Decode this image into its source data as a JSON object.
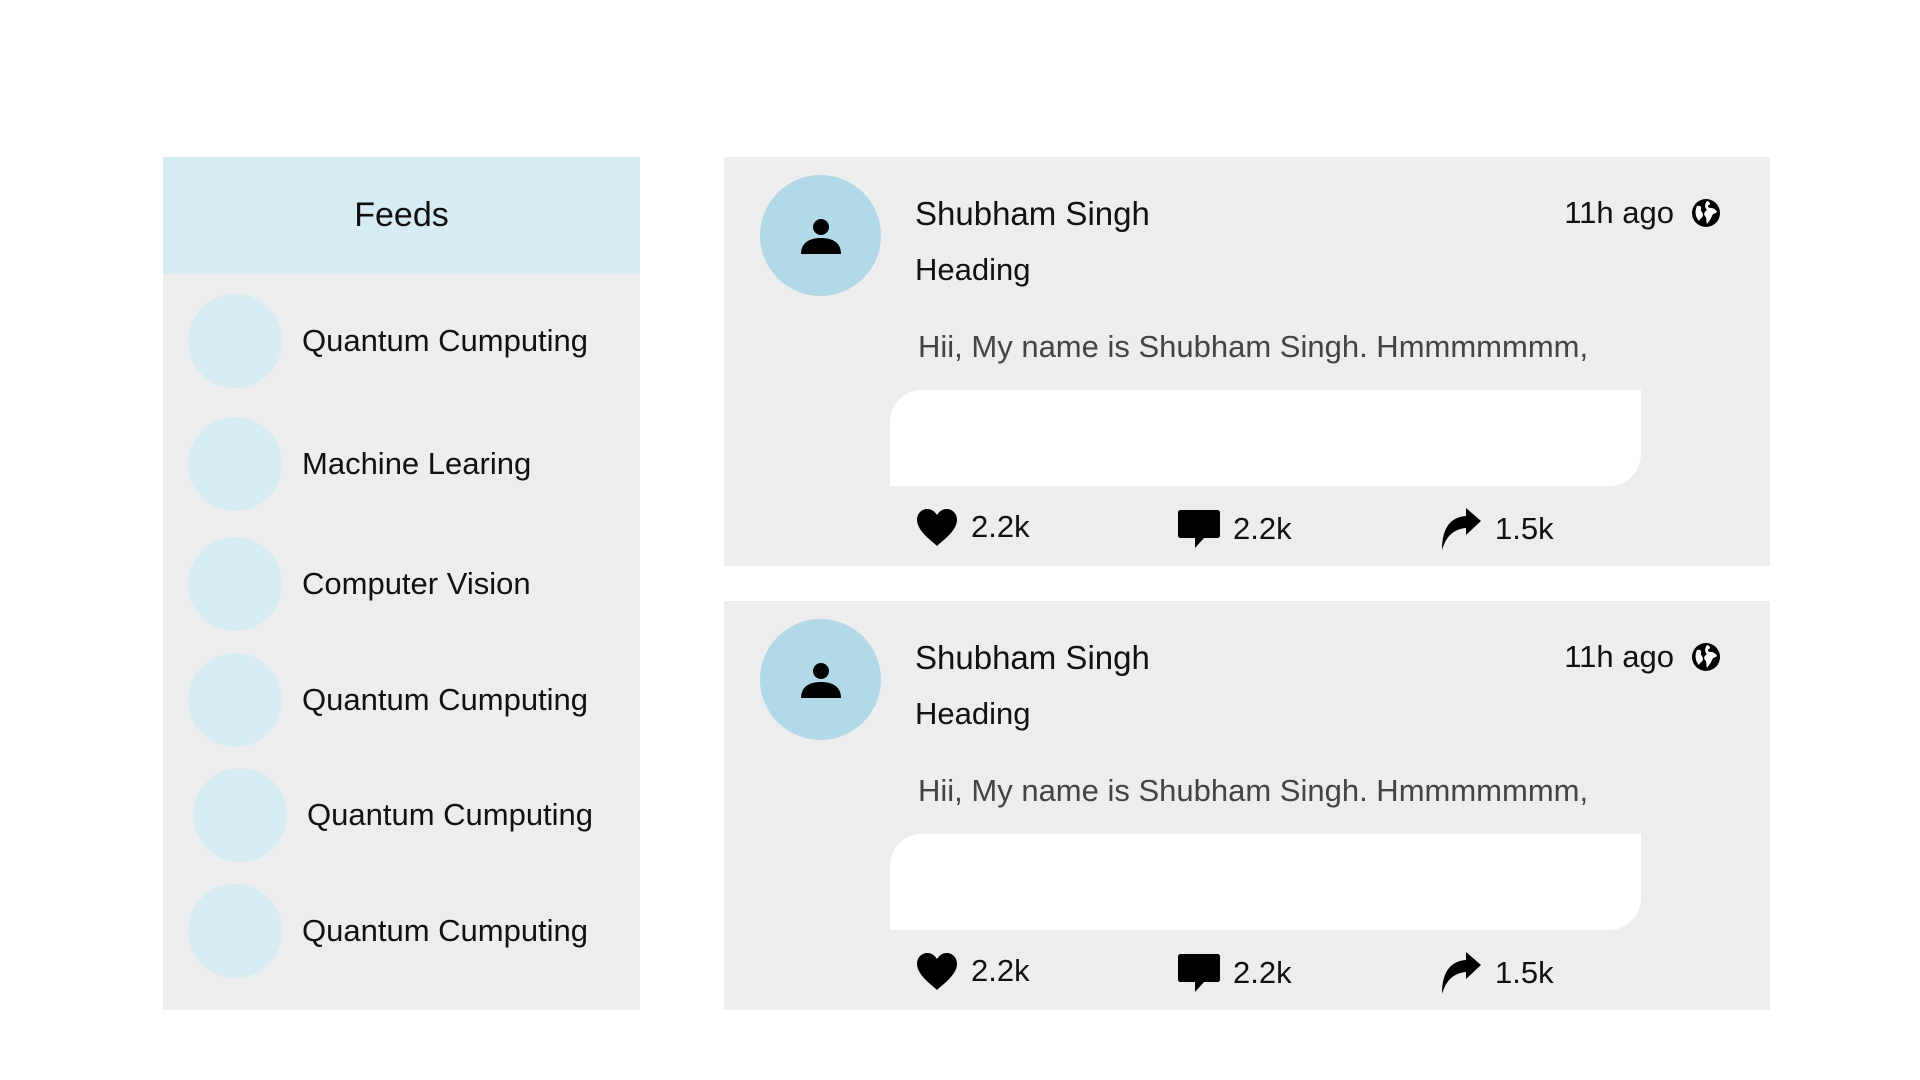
{
  "sidebar": {
    "title": "Feeds",
    "items": [
      {
        "label": "Quantum Cumputing"
      },
      {
        "label": "Machine Learing"
      },
      {
        "label": "Computer Vision"
      },
      {
        "label": "Quantum Cumputing"
      },
      {
        "label": "Quantum Cumputing"
      },
      {
        "label": "Quantum Cumputing"
      }
    ]
  },
  "posts": [
    {
      "author": "Shubham Singh",
      "heading": "Heading",
      "time": "11h ago",
      "text": "Hii, My name is Shubham Singh. Hmmmmmmm,",
      "likes": "2.2k",
      "comments": "2.2k",
      "shares": "1.5k"
    },
    {
      "author": "Shubham Singh",
      "heading": "Heading",
      "time": "11h ago",
      "text": "Hii, My name is Shubham Singh. Hmmmmmmm,",
      "likes": "2.2k",
      "comments": "2.2k",
      "shares": "1.5k"
    }
  ],
  "icons": {
    "avatar": "user-icon",
    "visibility": "globe-icon",
    "like": "heart-icon",
    "comment": "comment-icon",
    "share": "share-icon"
  },
  "colors": {
    "panel": "#ededed",
    "accent_light": "#d7ebf2",
    "avatar_bg": "#b1d9e8"
  }
}
